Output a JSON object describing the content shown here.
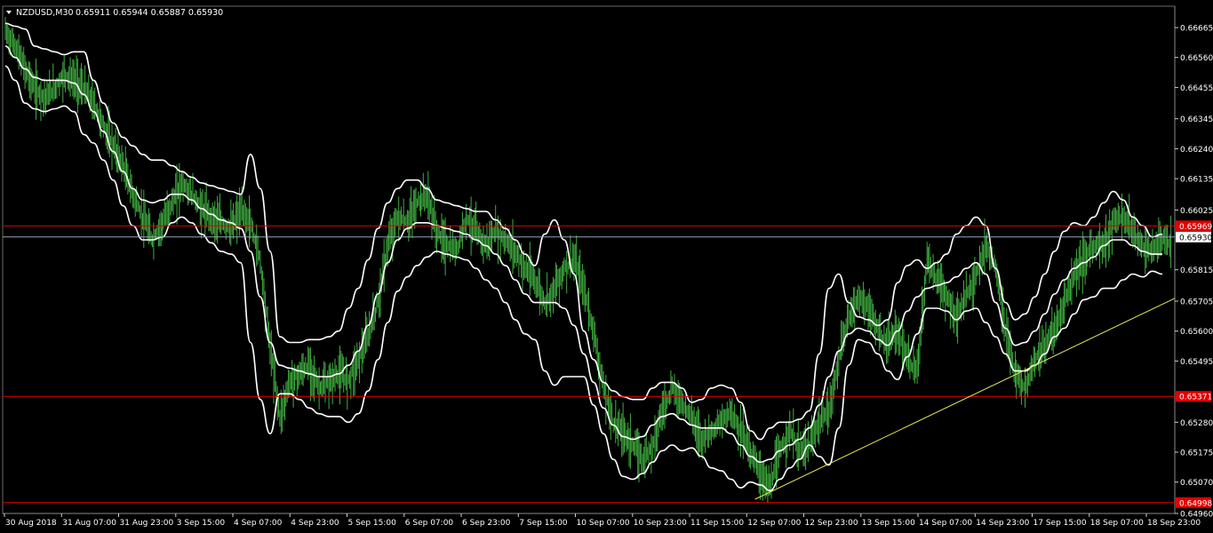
{
  "header": {
    "symbol_label": "NZDUSD,M30",
    "ohlc": "0.65911 0.65944 0.65887 0.65930"
  },
  "colors": {
    "background": "#000000",
    "candle": "#3fae3f",
    "bands": "#ffffff",
    "level_line": "#e00000",
    "trendline": "#e6e85a",
    "price_line": "#9aa3b0",
    "price_tag_bg": "#ffffff",
    "level_tag_bg": "#e00000"
  },
  "chart_data": {
    "type": "line",
    "title": "NZDUSD,M30",
    "ylim": [
      0.6496,
      0.6674
    ],
    "y_ticks": [
      "0.66665",
      "0.66560",
      "0.66455",
      "0.66345",
      "0.66240",
      "0.66135",
      "0.66025",
      "0.65815",
      "0.65705",
      "0.65600",
      "0.65495",
      "0.65280",
      "0.65175",
      "0.65070",
      "0.64960"
    ],
    "y_tick_values": [
      0.66665,
      0.6656,
      0.66455,
      0.66345,
      0.6624,
      0.66135,
      0.66025,
      0.65815,
      0.65705,
      0.656,
      0.65495,
      0.6528,
      0.65175,
      0.6507,
      0.6496
    ],
    "x_ticks": [
      "30 Aug 2018",
      "31 Aug 07:00",
      "31 Aug 23:00",
      "3 Sep 15:00",
      "4 Sep 07:00",
      "4 Sep 23:00",
      "5 Sep 15:00",
      "6 Sep 07:00",
      "6 Sep 23:00",
      "7 Sep 15:00",
      "10 Sep 07:00",
      "10 Sep 23:00",
      "11 Sep 15:00",
      "12 Sep 07:00",
      "12 Sep 23:00",
      "13 Sep 15:00",
      "14 Sep 07:00",
      "14 Sep 23:00",
      "17 Sep 15:00",
      "18 Sep 07:00",
      "18 Sep 23:00"
    ],
    "current_price": "0.65930",
    "current_price_value": 0.6593,
    "levels": [
      {
        "label": "0.65969",
        "value": 0.65969
      },
      {
        "label": "0.65371",
        "value": 0.65371
      },
      {
        "label": "0.64998",
        "value": 0.64998
      }
    ],
    "trendline": [
      {
        "x": 0.6419,
        "y": 0.6501
      },
      {
        "x": 1.0,
        "y": 0.65715
      }
    ],
    "series": [
      {
        "values": [
          0.6665,
          0.666,
          0.6652,
          0.6645,
          0.6642,
          0.6645,
          0.665,
          0.6648,
          0.6645,
          0.664,
          0.6632,
          0.6625,
          0.6618,
          0.6608,
          0.66,
          0.6592,
          0.6598,
          0.6605,
          0.6612,
          0.6608,
          0.6603,
          0.66,
          0.6598,
          0.6596,
          0.6602,
          0.6598,
          0.6585,
          0.6555,
          0.653,
          0.6542,
          0.6545,
          0.6548,
          0.654,
          0.6542,
          0.6545,
          0.6543,
          0.655,
          0.6558,
          0.657,
          0.659,
          0.66,
          0.6598,
          0.6605,
          0.6608,
          0.6595,
          0.659,
          0.6588,
          0.66,
          0.6595,
          0.659,
          0.6595,
          0.6592,
          0.6588,
          0.6582,
          0.6578,
          0.657,
          0.6575,
          0.6582,
          0.6585,
          0.6575,
          0.656,
          0.654,
          0.6528,
          0.6525,
          0.652,
          0.6515,
          0.652,
          0.6532,
          0.654,
          0.6535,
          0.653,
          0.6522,
          0.6525,
          0.6528,
          0.6532,
          0.6525,
          0.6518,
          0.651,
          0.6505,
          0.6518,
          0.6525,
          0.6518,
          0.652,
          0.6528,
          0.6532,
          0.655,
          0.6565,
          0.6572,
          0.6568,
          0.656,
          0.6555,
          0.656,
          0.655,
          0.6545,
          0.6585,
          0.6578,
          0.6572,
          0.6565,
          0.6572,
          0.658,
          0.659,
          0.6582,
          0.656,
          0.6545,
          0.654,
          0.655,
          0.6555,
          0.656,
          0.657,
          0.658,
          0.6585,
          0.659,
          0.659,
          0.6598,
          0.66,
          0.6595,
          0.659,
          0.6588,
          0.6592,
          0.659
        ]
      },
      {
        "values": [
          0.666,
          0.6656,
          0.6652,
          0.6649,
          0.6648,
          0.6648,
          0.6648,
          0.6647,
          0.6643,
          0.6637,
          0.663,
          0.6623,
          0.6616,
          0.661,
          0.6606,
          0.6605,
          0.6606,
          0.6608,
          0.6608,
          0.6606,
          0.6603,
          0.6601,
          0.6599,
          0.6598,
          0.6596,
          0.6588,
          0.6572,
          0.6556,
          0.6548,
          0.6547,
          0.6546,
          0.6545,
          0.6544,
          0.6544,
          0.6545,
          0.6548,
          0.6553,
          0.6562,
          0.6573,
          0.6584,
          0.6592,
          0.6596,
          0.6598,
          0.6598,
          0.6597,
          0.6596,
          0.6595,
          0.6594,
          0.6592,
          0.659,
          0.6587,
          0.6583,
          0.6578,
          0.6573,
          0.657,
          0.657,
          0.657,
          0.6568,
          0.6562,
          0.6552,
          0.6542,
          0.6533,
          0.6527,
          0.6523,
          0.6522,
          0.6523,
          0.6527,
          0.653,
          0.6531,
          0.6529,
          0.6527,
          0.6526,
          0.6526,
          0.6526,
          0.6524,
          0.652,
          0.6516,
          0.6514,
          0.6515,
          0.6518,
          0.652,
          0.6522,
          0.6526,
          0.6534,
          0.6544,
          0.6553,
          0.6559,
          0.6561,
          0.656,
          0.6557,
          0.6555,
          0.656,
          0.6567,
          0.6572,
          0.6575,
          0.6576,
          0.6577,
          0.6579,
          0.6582,
          0.6584,
          0.658,
          0.657,
          0.6561,
          0.6555,
          0.6556,
          0.656,
          0.6566,
          0.6573,
          0.6578,
          0.6582,
          0.6584,
          0.6586,
          0.659,
          0.6592,
          0.6592,
          0.659,
          0.6588,
          0.6587,
          0.6587
        ]
      },
      {
        "values": [
          0.6668,
          0.6667,
          0.6666,
          0.666,
          0.6659,
          0.6658,
          0.6657,
          0.6658,
          0.6658,
          0.6648,
          0.664,
          0.6633,
          0.6628,
          0.6625,
          0.6622,
          0.662,
          0.662,
          0.6618,
          0.6616,
          0.6614,
          0.6612,
          0.6611,
          0.661,
          0.6609,
          0.6608,
          0.6622,
          0.661,
          0.6588,
          0.6558,
          0.6556,
          0.6556,
          0.6557,
          0.6557,
          0.6558,
          0.656,
          0.6568,
          0.6575,
          0.6585,
          0.6596,
          0.6605,
          0.661,
          0.6613,
          0.6613,
          0.661,
          0.6606,
          0.6605,
          0.6604,
          0.6603,
          0.6602,
          0.6602,
          0.6599,
          0.6596,
          0.6592,
          0.6587,
          0.6583,
          0.6594,
          0.6599,
          0.6592,
          0.658,
          0.656,
          0.655,
          0.6542,
          0.6539,
          0.6537,
          0.6536,
          0.6536,
          0.654,
          0.6542,
          0.6542,
          0.654,
          0.6535,
          0.6536,
          0.654,
          0.6541,
          0.654,
          0.6535,
          0.6525,
          0.6522,
          0.6526,
          0.6528,
          0.6528,
          0.6529,
          0.6532,
          0.6552,
          0.6575,
          0.658,
          0.657,
          0.6565,
          0.6564,
          0.6562,
          0.6564,
          0.6577,
          0.6583,
          0.6585,
          0.6582,
          0.6584,
          0.6587,
          0.6594,
          0.6597,
          0.66,
          0.6597,
          0.6582,
          0.657,
          0.6564,
          0.6566,
          0.6572,
          0.658,
          0.6588,
          0.6595,
          0.6598,
          0.6597,
          0.66,
          0.6605,
          0.6609,
          0.6606,
          0.66,
          0.6597,
          0.6593,
          0.6594
        ]
      },
      {
        "values": [
          0.6653,
          0.6648,
          0.664,
          0.6638,
          0.6637,
          0.6638,
          0.6639,
          0.6637,
          0.6629,
          0.6626,
          0.662,
          0.6613,
          0.6604,
          0.6597,
          0.6592,
          0.6592,
          0.6593,
          0.6598,
          0.66,
          0.6598,
          0.6594,
          0.6591,
          0.6588,
          0.6587,
          0.6584,
          0.6556,
          0.6536,
          0.6524,
          0.6538,
          0.6538,
          0.6536,
          0.6533,
          0.6531,
          0.653,
          0.653,
          0.6528,
          0.6531,
          0.6539,
          0.655,
          0.6563,
          0.6574,
          0.6579,
          0.6583,
          0.6586,
          0.6588,
          0.6587,
          0.6586,
          0.6585,
          0.6582,
          0.6578,
          0.6575,
          0.657,
          0.6564,
          0.6559,
          0.6557,
          0.6546,
          0.6541,
          0.6544,
          0.6544,
          0.6544,
          0.6534,
          0.6524,
          0.6515,
          0.6509,
          0.6508,
          0.651,
          0.6514,
          0.6518,
          0.652,
          0.6518,
          0.6519,
          0.6516,
          0.6512,
          0.6511,
          0.6508,
          0.6505,
          0.6507,
          0.6506,
          0.6504,
          0.6508,
          0.6512,
          0.6515,
          0.652,
          0.6516,
          0.6513,
          0.6526,
          0.6548,
          0.6557,
          0.6556,
          0.6552,
          0.6546,
          0.6543,
          0.6551,
          0.6559,
          0.6568,
          0.6568,
          0.6567,
          0.6564,
          0.6567,
          0.6568,
          0.6563,
          0.6558,
          0.6552,
          0.6546,
          0.6546,
          0.6548,
          0.6552,
          0.6558,
          0.6561,
          0.6566,
          0.6571,
          0.6572,
          0.6575,
          0.6575,
          0.6578,
          0.658,
          0.6579,
          0.6581,
          0.658
        ]
      }
    ]
  }
}
